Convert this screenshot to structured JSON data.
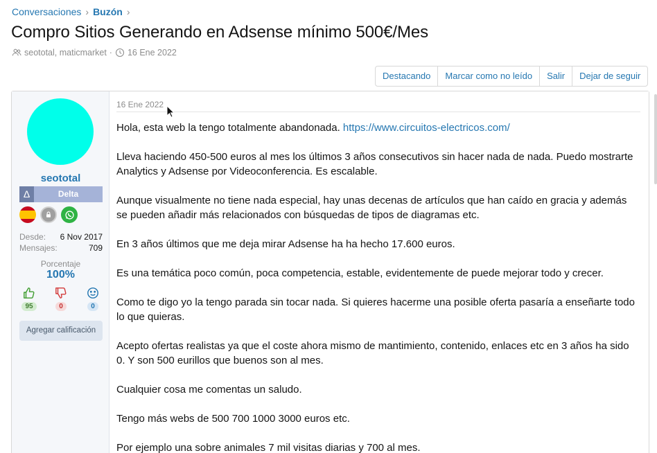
{
  "breadcrumb": {
    "items": [
      {
        "label": "Conversaciones"
      },
      {
        "label": "Buzón"
      }
    ],
    "separator": "›"
  },
  "title": "Compro Sitios Generando en Adsense mínimo 500€/Mes",
  "meta": {
    "participants": "seototal, maticmarket",
    "dot": "·",
    "date": "16 Ene 2022"
  },
  "actions": [
    {
      "label": "Destacando"
    },
    {
      "label": "Marcar como no leído"
    },
    {
      "label": "Salir"
    },
    {
      "label": "Dejar de seguir"
    }
  ],
  "user": {
    "avatar_color": "#00ffea",
    "name": "seototal",
    "title_symbol": "Δ",
    "title": "Delta",
    "badges": [
      "spain-flag-icon",
      "lock-icon",
      "whatsapp-icon"
    ],
    "stats": [
      {
        "key": "Desde:",
        "value": "6 Nov 2017"
      },
      {
        "key": "Mensajes:",
        "value": "709"
      }
    ],
    "percent_label": "Porcentaje",
    "percent_value": "100%",
    "ratings": {
      "positive": "95",
      "negative": "0",
      "neutral": "0"
    },
    "rate_button": "Agregar calificación"
  },
  "post": {
    "date": "16 Ene 2022",
    "intro": "Hola, esta web la tengo totalmente abandonada.",
    "link": "https://www.circuitos-electricos.com/",
    "paragraphs": [
      "Lleva haciendo 450-500 euros al mes los últimos 3 años consecutivos sin hacer nada de nada. Puedo mostrarte Analytics y Adsense por Videoconferencia. Es escalable.",
      "Aunque visualmente no tiene nada especial, hay unas decenas de artículos que han caído en gracia y además se pueden añadir más relacionados con búsquedas de tipos de diagramas etc.",
      "En 3 años últimos que me deja mirar Adsense ha ha hecho 17.600 euros.",
      "Es una temática poco común, poca competencia, estable, evidentemente de puede mejorar todo y crecer.",
      "Como te digo yo la tengo parada sin tocar nada. Si quieres hacerme una posible oferta pasaría a enseñarte todo lo que quieras.",
      "Acepto ofertas realistas ya que el coste ahora mismo de mantimiento, contenido, enlaces etc en 3 años ha sido 0. Y son 500 eurillos que buenos son al mes.",
      "Cualquier cosa me comentas un saludo.",
      "Tengo más webs de 500 700 1000 3000 euros etc.",
      "Por ejemplo una sobre animales 7 mil visitas diarias y 700 al mes."
    ]
  },
  "colors": {
    "link": "#2577b1",
    "muted": "#8c8c8c"
  }
}
